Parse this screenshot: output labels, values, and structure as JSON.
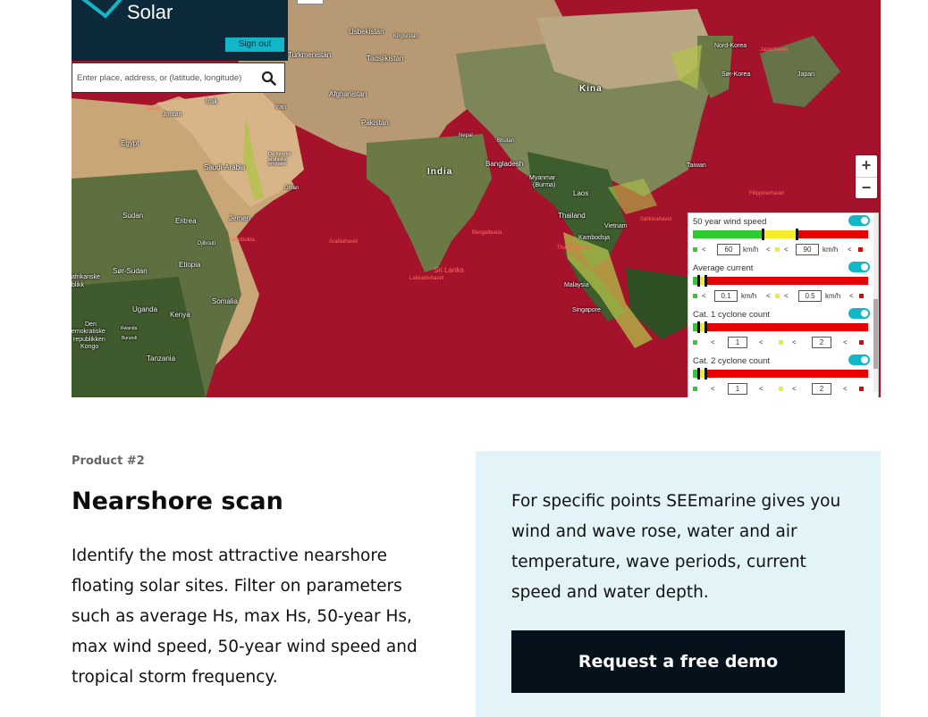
{
  "app": {
    "logo_text": "Solar",
    "sign_out_label": "Sign out",
    "search_placeholder": "Enter place, address, or (latitude, longitude)"
  },
  "map": {
    "labels": {
      "uzbekistan": "Usbekistan",
      "kirgisistan": "Kirgisistan",
      "turkmenistan": "Turkmenistan",
      "tadsjikistan": "Tadsjikistan",
      "afghanistan": "Afghanistan",
      "pakistan": "Pakistan",
      "irak": "Irak",
      "iran": "Iran",
      "israel": "Israel",
      "jordan": "Jordan",
      "egypt": "Egypt",
      "saudi_arabia": "Saudi-Arabia",
      "uae": "De forente arabiske emirater",
      "oman": "Oman",
      "sudan": "Sudan",
      "eritrea": "Eritrea",
      "jemen": "Jemen",
      "djibouti": "Djibouti",
      "adenbukta": "Adenbukta",
      "arabiahavet": "Arabiahavet",
      "etiopia": "Etiopia",
      "sor_sudan": "Sør-Sudan",
      "sentralafrikanske": "afrikanske",
      "republikk": "blikk",
      "somalia": "Somalia",
      "uganda": "Uganda",
      "kenya": "Kenya",
      "den": "Den",
      "demokratiske": "emokratiske",
      "republikken": "republikken",
      "kongo": "Kongo",
      "rwanda": "Rwanda",
      "burundi": "Burundi",
      "tanzania": "Tanzania",
      "kina": "Kina",
      "nepal": "Nepal",
      "bhutan": "Bhutan",
      "india": "India",
      "bangladesh": "Bangladesh",
      "myanmar": "Myanmar",
      "burma": "(Burma)",
      "laos": "Laos",
      "thailand": "Thailand",
      "vietnam": "Vietnam",
      "kambodsja": "Kambodsja",
      "bengalbukta": "Bengalbukta",
      "sri_lanka": "Sri Lanka",
      "lakkadivhavet": "Lakkadivhavet",
      "malaysia": "Malaysia",
      "singapore": "Singapore",
      "nord_korea": "Nord-Korea",
      "sor_korea": "Sør-Korea",
      "japan": "Japan",
      "japanhavet": "Japanhavet",
      "taiwan": "Taiwan",
      "filippinerhavet": "Filippinerhavet",
      "sorkinahavet": "Sørkinahavet",
      "thailandbukta": "Thailandbukta"
    },
    "zoom_in": "+",
    "zoom_out": "−"
  },
  "filters": [
    {
      "title": "50 year wind speed",
      "min": "60",
      "max": "90",
      "unit": "km/h",
      "enabled": true
    },
    {
      "title": "Average current",
      "min": "0.1",
      "max": "0.5",
      "unit": "km/h",
      "enabled": true
    },
    {
      "title": "Cat. 1 cyclone count",
      "min": "1",
      "max": "2",
      "unit": "",
      "enabled": true
    },
    {
      "title": "Cat. 2 cyclone count",
      "min": "1",
      "max": "2",
      "unit": "",
      "enabled": true
    }
  ],
  "product": {
    "eyebrow": "Product #2",
    "title": "Nearshore scan",
    "description": "Identify the most attractive nearshore floating solar sites. Filter on parameters such as average Hs, max Hs, 50-year Hs, max wind speed, 50-year wind speed and tropical storm frequency.",
    "callout_text": "For specific points SEEmarine gives you wind and wave rose, water and air temperature, wave periods, current speed and water depth.",
    "cta_label": "Request a free demo"
  },
  "colors": {
    "sea_highlight": "#a5122c",
    "app_header": "#0c2a3a",
    "accent": "#13b6c6",
    "callout_bg": "#e2f4f7",
    "cta_bg": "#06121b"
  }
}
